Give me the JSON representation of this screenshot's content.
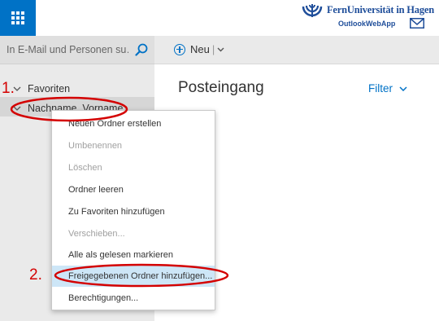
{
  "header": {
    "brand_name": "FernUniversität in Hagen",
    "brand_app": "OutlookWebApp",
    "accent": "#0072c6"
  },
  "search": {
    "placeholder": "In E-Mail und Personen su…"
  },
  "toolbar": {
    "new_label": "Neu",
    "sep": "|"
  },
  "folders": {
    "favorites": "Favoriten",
    "user": "Nachname, Vorname"
  },
  "main": {
    "title": "Posteingang",
    "filter_label": "Filter"
  },
  "context_menu": {
    "items": [
      {
        "label": "Neuen Ordner erstellen",
        "enabled": true
      },
      {
        "label": "Umbenennen",
        "enabled": false
      },
      {
        "label": "Löschen",
        "enabled": false
      },
      {
        "label": "Ordner leeren",
        "enabled": true
      },
      {
        "label": "Zu Favoriten hinzufügen",
        "enabled": true
      },
      {
        "label": "Verschieben...",
        "enabled": false
      },
      {
        "label": "Alle als gelesen markieren",
        "enabled": true
      },
      {
        "label": "Freigegebenen Ordner hinzufügen...",
        "enabled": true,
        "hovered": true
      },
      {
        "label": "Berechtigungen...",
        "enabled": true
      }
    ]
  },
  "annotations": {
    "step1": "1.",
    "step2": "2.",
    "color": "#d40000"
  },
  "icons": {
    "app_launcher": "waffle-grid-icon",
    "search": "magnifier-icon",
    "new": "plus-circle-icon",
    "dropdown": "chevron-down-icon",
    "brand_mail": "envelope-icon"
  }
}
